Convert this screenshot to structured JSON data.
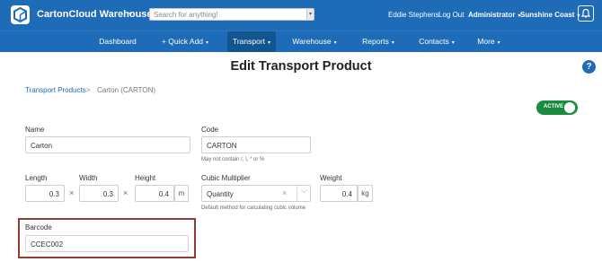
{
  "app": {
    "title": "CartonCloud Warehouse",
    "title_caret": "▾",
    "search_placeholder": "Search for anything!",
    "search_caret": "▾",
    "user_name": "Eddie Stephens",
    "logout": "Log Out",
    "role": "Administrator",
    "region": "Sunshine Coast",
    "caret": "▾",
    "accent_color": "#1e6bb8"
  },
  "nav": {
    "dashboard": "Dashboard",
    "quick_add": "+ Quick Add",
    "transport": "Transport",
    "warehouse": "Warehouse",
    "reports": "Reports",
    "contacts": "Contacts",
    "more": "More",
    "caret": "▾"
  },
  "page": {
    "title": "Edit Transport Product",
    "help": "?"
  },
  "breadcrumb": {
    "parent": "Transport Products",
    "separator": ">",
    "current": "Carton (CARTON)"
  },
  "status_toggle": {
    "label": "ACTIVE",
    "on": true,
    "color": "#1a8b3f"
  },
  "form": {
    "name_label": "Name",
    "name_value": "Carton",
    "code_label": "Code",
    "code_value": "CARTON",
    "code_help": "May not contain /, \\, * or %",
    "length_label": "Length",
    "length_value": "0.3",
    "width_label": "Width",
    "width_value": "0.3",
    "height_label": "Height",
    "height_value": "0.4",
    "times": "×",
    "unit_m": "m",
    "cubic_label": "Cubic Multiplier",
    "cubic_value": "Quantity",
    "cubic_clear": "×",
    "cubic_caret": "⌵",
    "cubic_help": "Default method for calculating cubic volume",
    "weight_label": "Weight",
    "weight_value": "0.4",
    "unit_kg": "kg",
    "barcode_label": "Barcode",
    "barcode_value": "CCEC002"
  }
}
